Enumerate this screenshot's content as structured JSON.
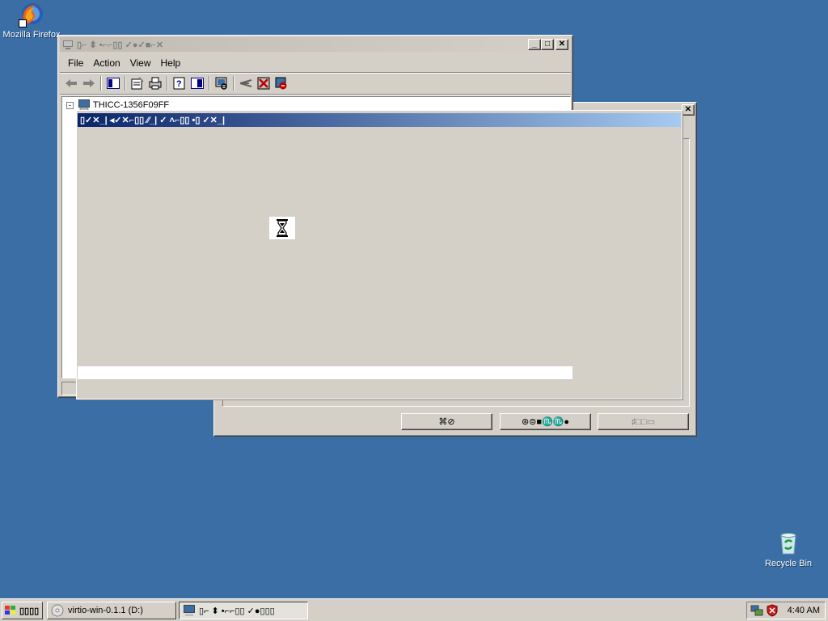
{
  "desktop": {
    "firefox_label": "Mozilla Firefox",
    "recycle_label": "Recycle Bin"
  },
  "mmc_window": {
    "title": "▯⌐ ⬍ •⌐⌐▯▯ ✓●✓■⌐✕",
    "menu": [
      "File",
      "Action",
      "View",
      "Help"
    ],
    "tree_root": "THICC-1356F09FF"
  },
  "dialog": {
    "title": "▯✓✕_| ◂✓✕⌐▯▯ ⁄⁄_| ✓ ˄⌐▯▯ •▯ ✓✕_|"
  },
  "back_dialog": {
    "buttons": [
      "⌘⊘",
      "⊛⊜■♏♏●",
      "♯□□▭"
    ]
  },
  "taskbar": {
    "start_label": "▯▯▯▯",
    "tasks": [
      "virtio-win-0.1.1 (D:)",
      "▯⌐ ⬍ •⌐⌐▯▯ ✓●▯▯▯"
    ],
    "clock": "4:40 AM"
  },
  "colors": {
    "desktop": "#3a6ea5",
    "window_face": "#d4d0c8",
    "active_title_start": "#0a246a",
    "active_title_end": "#a6caf0"
  }
}
